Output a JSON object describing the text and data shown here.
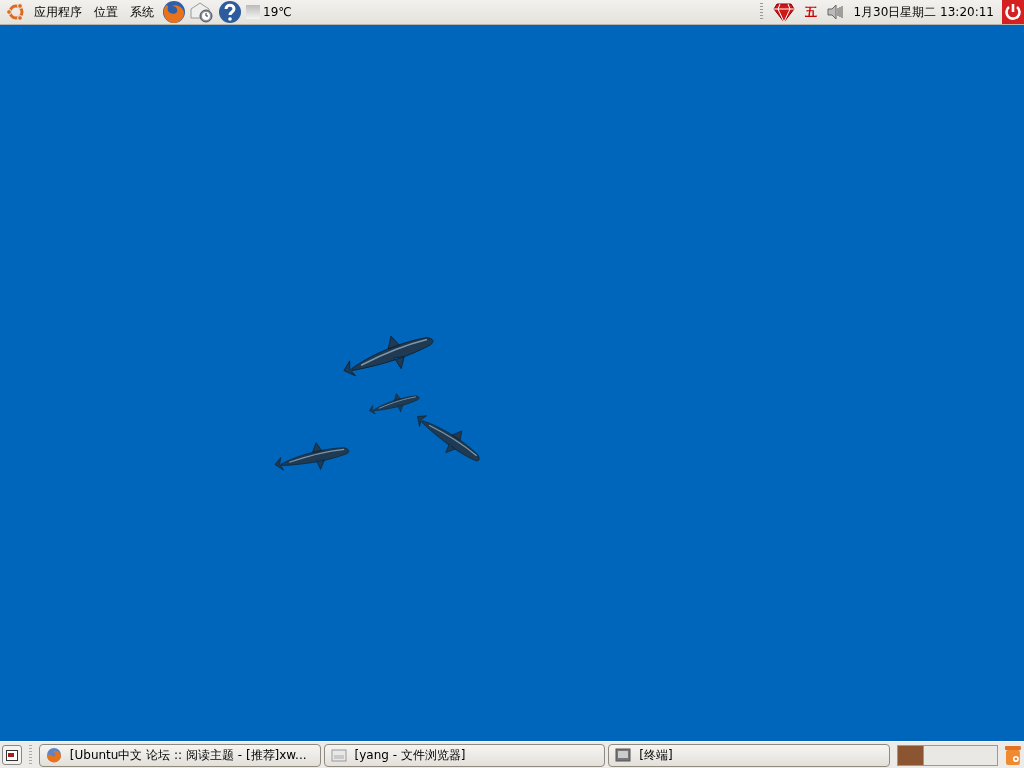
{
  "top_panel": {
    "menus": [
      "应用程序",
      "位置",
      "系统"
    ],
    "weather": "19℃",
    "input_method": "五",
    "clock": "1月30日星期二 13:20:11"
  },
  "bottom_panel": {
    "tasks": [
      {
        "title": "[Ubuntu中文 论坛 :: 阅读主题 - [推荐]xw...",
        "kind": "browser"
      },
      {
        "title": "[yang - 文件浏览器]",
        "kind": "folder"
      },
      {
        "title": "[终端]",
        "kind": "terminal"
      }
    ],
    "workspaces": [
      {
        "selected": true
      },
      {
        "selected": false
      }
    ]
  }
}
